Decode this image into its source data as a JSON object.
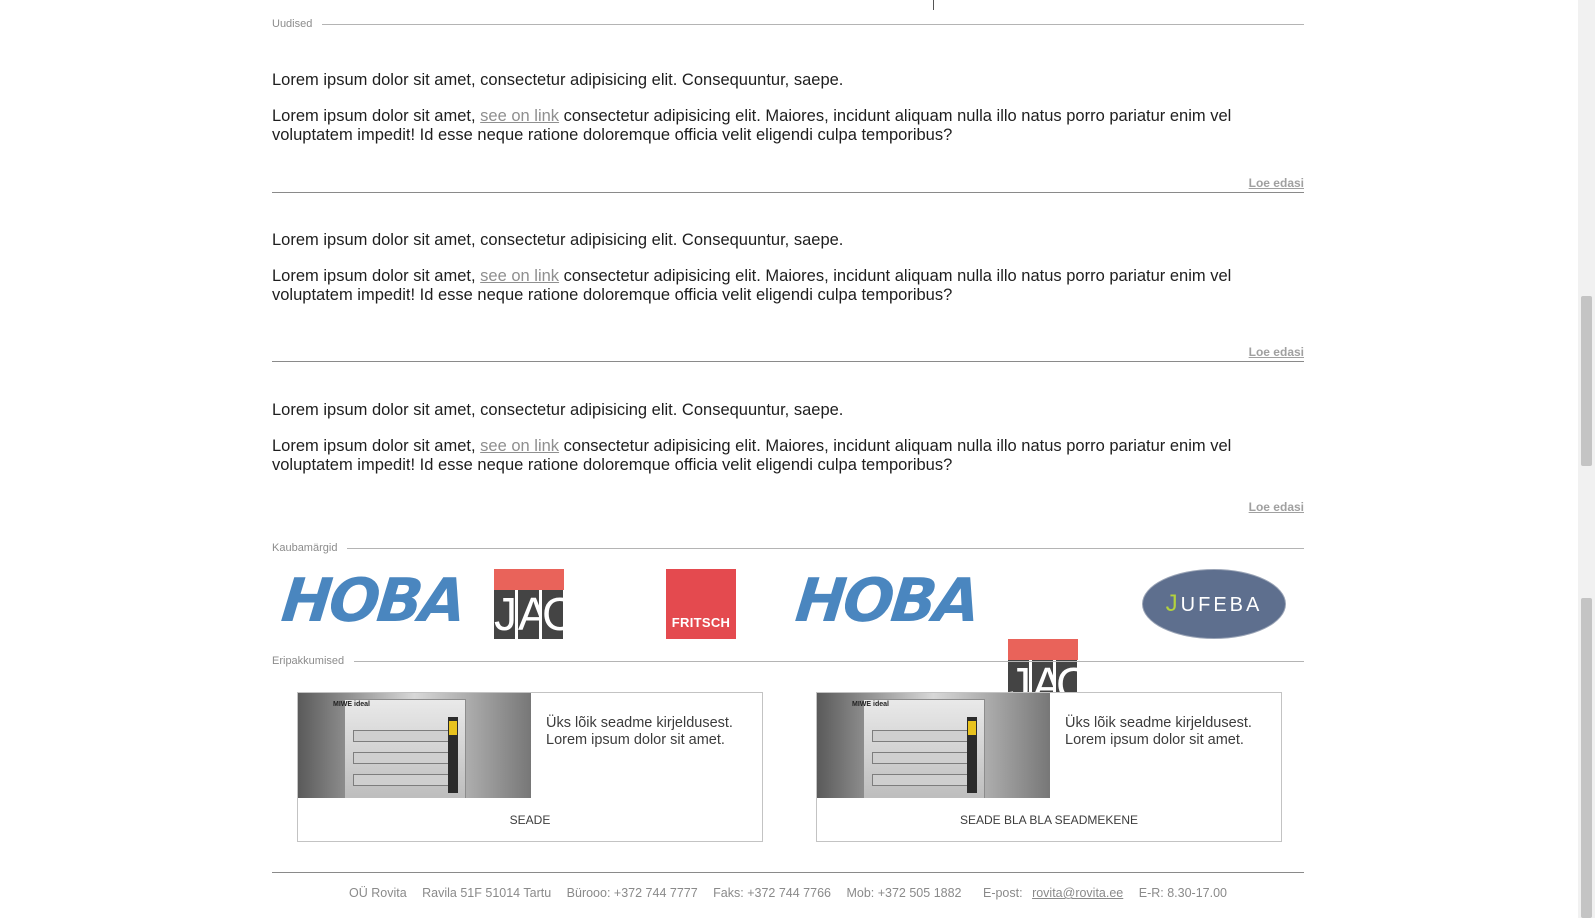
{
  "sections": {
    "news_label": "Uudised",
    "brands_label": "Kaubamärgid",
    "offers_label": "Eripakkumised"
  },
  "news": [
    {
      "title": "Lorem ipsum dolor sit amet, consectetur adipisicing elit. Consequuntur, saepe.",
      "body_before": "Lorem ipsum dolor sit amet, ",
      "link_text": "see on link",
      "body_after": " consectetur adipisicing elit. Maiores, incidunt aliquam nulla illo natus porro pariatur enim vel voluptatem impedit! Id esse neque ratione doloremque officia velit eligendi culpa temporibus?",
      "more_label": "Loe edasi"
    },
    {
      "title": "Lorem ipsum dolor sit amet, consectetur adipisicing elit. Consequuntur, saepe.",
      "body_before": "Lorem ipsum dolor sit amet, ",
      "link_text": "see on link",
      "body_after": " consectetur adipisicing elit. Maiores, incidunt aliquam nulla illo natus porro pariatur enim vel voluptatem impedit! Id esse neque ratione doloremque officia velit eligendi culpa temporibus?",
      "more_label": "Loe edasi"
    },
    {
      "title": "Lorem ipsum dolor sit amet, consectetur adipisicing elit. Consequuntur, saepe.",
      "body_before": "Lorem ipsum dolor sit amet, ",
      "link_text": "see on link",
      "body_after": " consectetur adipisicing elit. Maiores, incidunt aliquam nulla illo natus porro pariatur enim vel voluptatem impedit! Id esse neque ratione doloremque officia velit eligendi culpa temporibus?",
      "more_label": "Loe edasi"
    }
  ],
  "brands": {
    "hoba": "HOBA",
    "fritsch": "FRITSCH",
    "jufeba_j": "J",
    "jufeba_rest": "UFEBA"
  },
  "offers": [
    {
      "description": "Üks lõik seadme kirjeldusest. Lorem ipsum dolor sit amet.",
      "name": "SEADE",
      "image_brand": "MIWE ideal"
    },
    {
      "description": "Üks lõik seadme kirjeldusest. Lorem ipsum dolor sit amet.",
      "name": "SEADE BLA BLA SEADMEKENE",
      "image_brand": "MIWE ideal"
    }
  ],
  "footer": {
    "company": "OÜ Rovita",
    "address": "Ravila 51F 51014 Tartu",
    "office": "Bürooo: +372 744 7777",
    "fax": "Faks: +372 744 7766",
    "mobile": "Mob: +372 505 1882",
    "email_label": "E-post: ",
    "email": "rovita@rovita.ee",
    "hours": "E-R: 8.30-17.00"
  },
  "colors": {
    "link": "#8f8f8f",
    "hoba_blue": "#4a86bf",
    "jac_red": "#e9635a",
    "fritsch_red": "#e44a4f",
    "jufeba_blue": "#5e6f8e",
    "jufeba_green": "#b3d23d"
  }
}
